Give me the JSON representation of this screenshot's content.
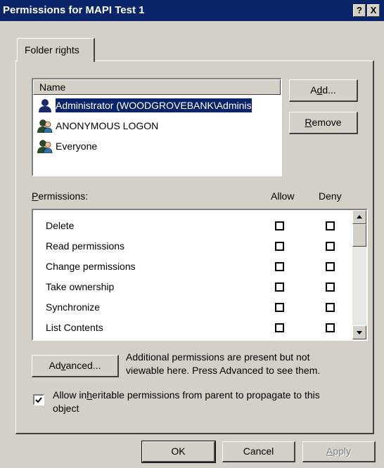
{
  "window": {
    "title": "Permissions for MAPI Test 1",
    "help_label": "?",
    "close_label": "X"
  },
  "tabs": [
    {
      "label": "Folder rights"
    }
  ],
  "names_list": {
    "header": "Name",
    "items": [
      {
        "label": "Administrator (WOODGROVEBANK\\Adminis",
        "icon": "user-icon",
        "selected": true
      },
      {
        "label": "ANONYMOUS LOGON",
        "icon": "group-icon",
        "selected": false
      },
      {
        "label": "Everyone",
        "icon": "group-icon",
        "selected": false
      }
    ]
  },
  "buttons": {
    "add": {
      "pre": "A",
      "accel": "d",
      "post": "d..."
    },
    "remove": {
      "pre": "",
      "accel": "R",
      "post": "emove"
    },
    "advanced": {
      "pre": "Ad",
      "accel": "v",
      "post": "anced..."
    },
    "ok": "OK",
    "cancel": "Cancel",
    "apply": {
      "pre": "",
      "accel": "A",
      "post": "pply"
    }
  },
  "permissions": {
    "label": {
      "pre": "",
      "accel": "P",
      "post": "ermissions:"
    },
    "allow_header": "Allow",
    "deny_header": "Deny",
    "rows": [
      {
        "name": "Delete",
        "allow": false,
        "deny": false
      },
      {
        "name": "Read permissions",
        "allow": false,
        "deny": false
      },
      {
        "name": "Change permissions",
        "allow": false,
        "deny": false
      },
      {
        "name": "Take ownership",
        "allow": false,
        "deny": false
      },
      {
        "name": "Synchronize",
        "allow": false,
        "deny": false
      },
      {
        "name": "List Contents",
        "allow": false,
        "deny": false
      }
    ]
  },
  "advanced_note": {
    "line1": "Additional permissions are present but not",
    "line2": "viewable here. Press Advanced to see them."
  },
  "inherit": {
    "checked": true,
    "line1_pre": "Allow in",
    "line1_accel": "h",
    "line1_post": "eritable permissions from parent to propagate to this",
    "line2": "object"
  }
}
